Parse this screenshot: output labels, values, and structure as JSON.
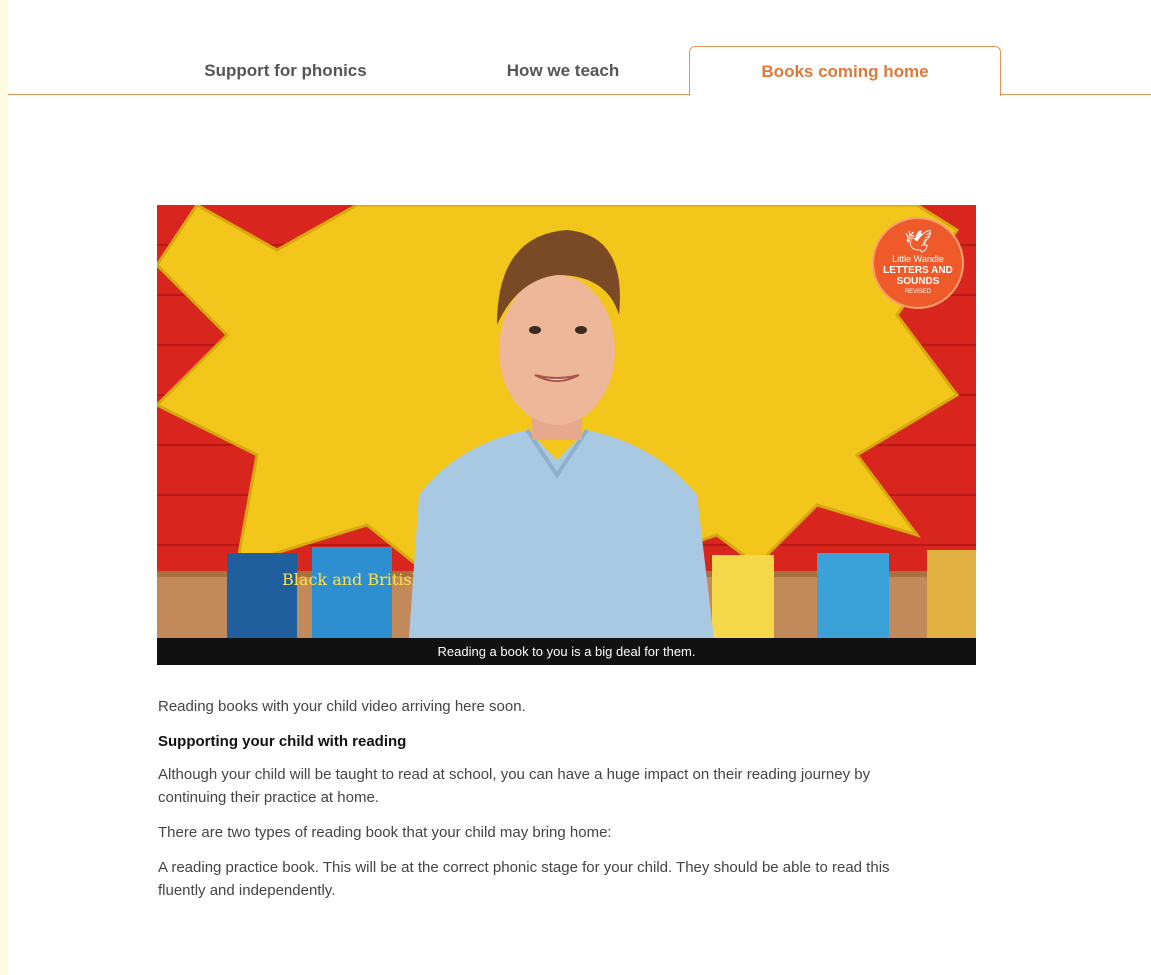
{
  "tabs": [
    {
      "label": "Support for phonics",
      "active": false
    },
    {
      "label": "How we teach",
      "active": false
    },
    {
      "label": "Books coming home",
      "active": true
    }
  ],
  "video": {
    "caption": "Reading a book to you is a big deal for them.",
    "badge": {
      "line1": "Little Wandle",
      "line2": "LETTERS AND SOUNDS",
      "line3": "REVISED"
    },
    "books": [
      "Black and British"
    ]
  },
  "content": {
    "intro": "Reading books with your child video arriving here soon.",
    "heading": "Supporting your child with reading",
    "para1": "Although your child will be taught to read at school, you can have a huge impact on their reading journey by continuing their practice at home.",
    "para2": "There are two types of reading book that your child may bring home:",
    "para3": "A reading practice book. This will be at the correct phonic stage for your child. They should be able to read this fluently and independently."
  },
  "colors": {
    "accent": "#e0783a",
    "tab_border": "#e8925a",
    "page_bg": "#fffbe0"
  }
}
